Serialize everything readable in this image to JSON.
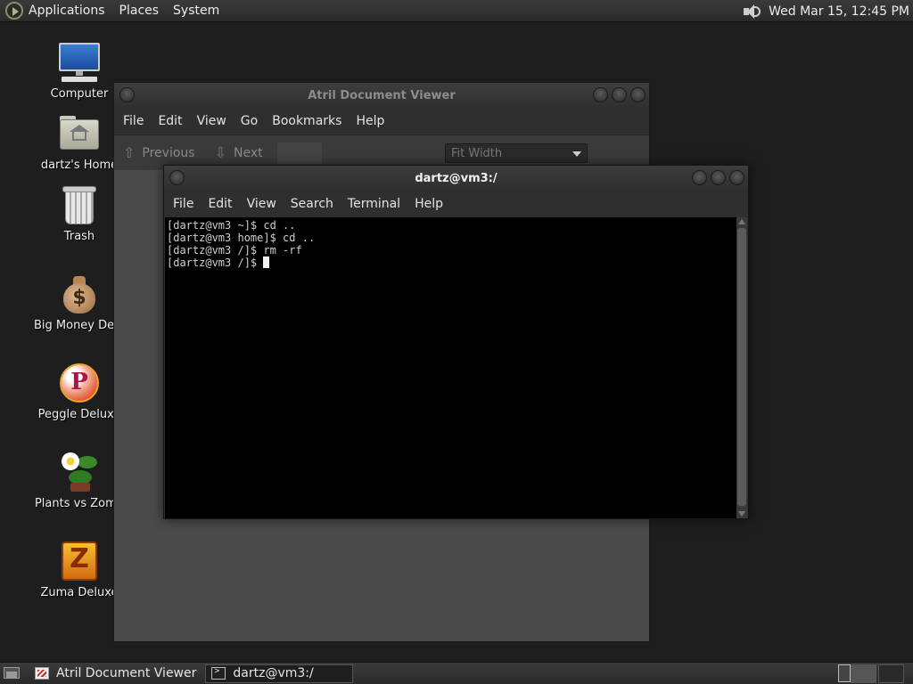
{
  "top_panel": {
    "menus": [
      "Applications",
      "Places",
      "System"
    ],
    "clock": "Wed Mar 15, 12:45 PM",
    "icons": [
      "apps-logo-icon",
      "volume-icon"
    ]
  },
  "desktop": {
    "icons": [
      {
        "label": "Computer",
        "icon": "computer-icon"
      },
      {
        "label": "dartz's Home",
        "icon": "home-folder-icon"
      },
      {
        "label": "Trash",
        "icon": "trash-icon"
      },
      {
        "label": "Big Money Delu",
        "icon": "money-bag-icon"
      },
      {
        "label": "Peggle Deluxe",
        "icon": "peggle-icon"
      },
      {
        "label": "Plants vs Zomb",
        "icon": "plants-icon"
      },
      {
        "label": "Zuma Deluxe",
        "icon": "zuma-icon"
      }
    ]
  },
  "atril": {
    "title": "Atril Document Viewer",
    "menu": [
      "File",
      "Edit",
      "View",
      "Go",
      "Bookmarks",
      "Help"
    ],
    "toolbar": {
      "previous": "Previous",
      "next": "Next",
      "zoom": "Fit Width"
    }
  },
  "terminal": {
    "title": "dartz@vm3:/",
    "menu": [
      "File",
      "Edit",
      "View",
      "Search",
      "Terminal",
      "Help"
    ],
    "lines": [
      "[dartz@vm3 ~]$ cd ..",
      "[dartz@vm3 home]$ cd ..",
      "[dartz@vm3 /]$ rm -rf",
      "[dartz@vm3 /]$ "
    ]
  },
  "bottom_panel": {
    "tasks": [
      {
        "label": "Atril Document Viewer",
        "icon": "atril-icon"
      },
      {
        "label": "dartz@vm3:/",
        "icon": "terminal-icon"
      }
    ]
  },
  "colors": {
    "desktop_bg": "#1e1e1e",
    "panel_bg": "#333333",
    "terminal_bg": "#000000",
    "terminal_fg": "#cfcfcf"
  }
}
